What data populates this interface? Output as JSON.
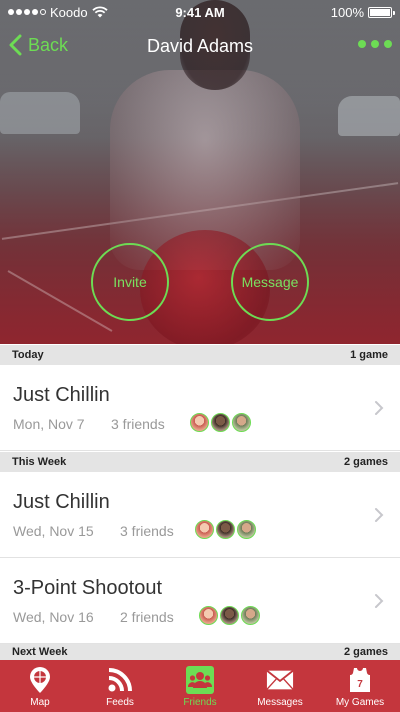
{
  "status_bar": {
    "carrier": "Koodo",
    "time": "9:41 AM",
    "battery": "100%"
  },
  "nav": {
    "back_label": "Back",
    "title": "David Adams"
  },
  "actions": {
    "invite_label": "Invite",
    "message_label": "Message"
  },
  "sections": [
    {
      "label": "Today",
      "count": "1 game"
    },
    {
      "label": "This Week",
      "count": "2 games"
    },
    {
      "label": "Next Week",
      "count": "2 games"
    }
  ],
  "games": [
    {
      "title": "Just Chillin",
      "date": "Mon, Nov 7",
      "friends": "3 friends"
    },
    {
      "title": "Just Chillin",
      "date": "Wed, Nov 15",
      "friends": "3 friends"
    },
    {
      "title": "3-Point Shootout",
      "date": "Wed, Nov 16",
      "friends": "2 friends"
    }
  ],
  "tabs": [
    {
      "label": "Map",
      "icon": "basketball-pin-icon"
    },
    {
      "label": "Feeds",
      "icon": "rss-feed-icon"
    },
    {
      "label": "Friends",
      "icon": "friends-group-icon",
      "active": true
    },
    {
      "label": "Messages",
      "icon": "envelope-icon"
    },
    {
      "label": "My Games",
      "icon": "jersey-icon"
    }
  ],
  "colors": {
    "accent_green": "#6ddc54",
    "tab_bar_red": "#c4363d",
    "section_header_bg": "#e4e4e4"
  }
}
